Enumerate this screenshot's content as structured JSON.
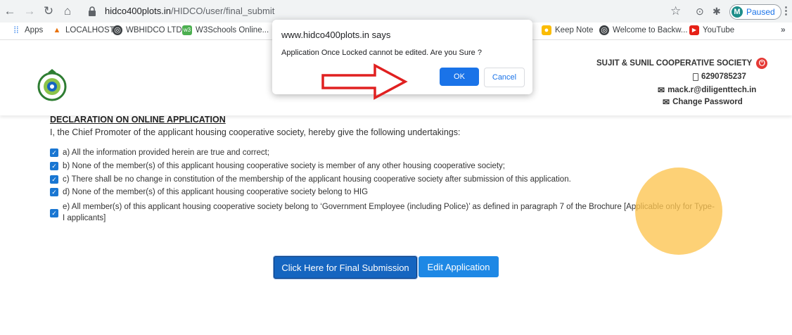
{
  "browser": {
    "url_domain": "hidco400plots.in",
    "url_path": "/HIDCO/user/final_submit",
    "profile_initial": "M",
    "profile_status": "Paused",
    "bookmarks": [
      {
        "label": "Apps",
        "icon": "apps-grid-icon"
      },
      {
        "label": "LOCALHOST",
        "icon": "localhost-icon"
      },
      {
        "label": "WBHIDCO LTD",
        "icon": "globe-icon"
      },
      {
        "label": "W3Schools Online...",
        "icon": "w3schools-icon"
      },
      {
        "label": "Keep Note",
        "icon": "keep-icon"
      },
      {
        "label": "Welcome to Backw...",
        "icon": "globe-icon"
      },
      {
        "label": "YouTube",
        "icon": "youtube-icon"
      }
    ],
    "more_label": "»"
  },
  "header": {
    "society_name": "SUJIT & SUNIL COOPERATIVE SOCIETY",
    "phone": "6290785237",
    "email": "mack.r@diligenttech.in",
    "change_password": "Change Password"
  },
  "declaration": {
    "title": "DECLARATION ON ONLINE APPLICATION",
    "intro": "I, the Chief Promoter of the applicant housing cooperative society, hereby give the following undertakings:",
    "items": [
      "a) All the information provided herein are true and correct;",
      "b) None of the member(s) of this applicant housing cooperative society is member of any other housing cooperative society;",
      "c) There shall be no change in constitution of the membership of the applicant housing cooperative society after submission of this application.",
      "d) None of the member(s) of this applicant housing cooperative society belong to HIG",
      "e) All member(s) of this applicant housing cooperative society belong to ‘Government Employee (including Police)’ as defined in paragraph 7 of the Brochure [Applicable only for Type-",
      "I applicants]"
    ]
  },
  "buttons": {
    "final_submission": "Click Here for Final Submission",
    "edit_application": "Edit Application"
  },
  "dialog": {
    "title": "www.hidco400plots.in says",
    "message": "Application Once Locked cannot be edited. Are you Sure ?",
    "ok": "OK",
    "cancel": "Cancel"
  },
  "colors": {
    "primary_button": "#1565c0",
    "secondary_button": "#1e88e5",
    "dialog_ok": "#1a73e8",
    "annotation_arrow": "#e02020",
    "cursor_highlight": "#fcc450"
  }
}
